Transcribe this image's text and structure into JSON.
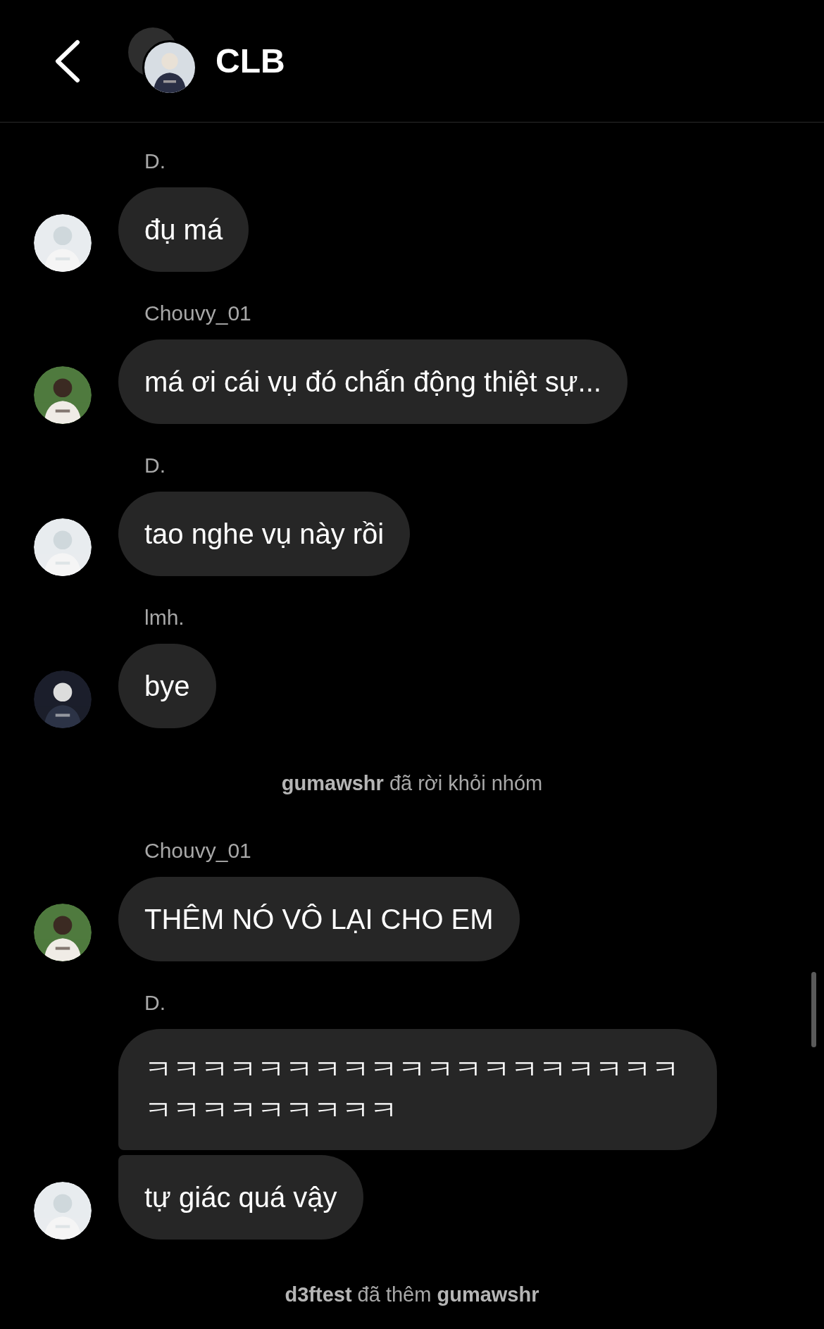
{
  "header": {
    "title": "CLB"
  },
  "thread": [
    {
      "kind": "group",
      "sender": "D.",
      "messages": [
        "đụ má"
      ]
    },
    {
      "kind": "group",
      "sender": "Chouvy_01",
      "messages": [
        "má ơi cái vụ đó chấn động thiệt sự..."
      ]
    },
    {
      "kind": "group",
      "sender": "D.",
      "messages": [
        "tao nghe vụ này rồi"
      ]
    },
    {
      "kind": "group",
      "sender": "lmh.",
      "messages": [
        "bye"
      ]
    },
    {
      "kind": "system",
      "text": "**gumawshr** đã rời khỏi nhóm"
    },
    {
      "kind": "group",
      "sender": "Chouvy_01",
      "messages": [
        "THÊM NÓ VÔ LẠI CHO EM"
      ]
    },
    {
      "kind": "group",
      "sender": "D.",
      "messages": [
        "ㅋㅋㅋㅋㅋㅋㅋㅋㅋㅋㅋㅋㅋㅋㅋㅋㅋㅋㅋㅋㅋㅋㅋㅋㅋㅋㅋㅋ",
        "tự giác quá vậy"
      ]
    },
    {
      "kind": "system",
      "text": "**d3ftest** đã thêm **gumawshr**"
    }
  ]
}
